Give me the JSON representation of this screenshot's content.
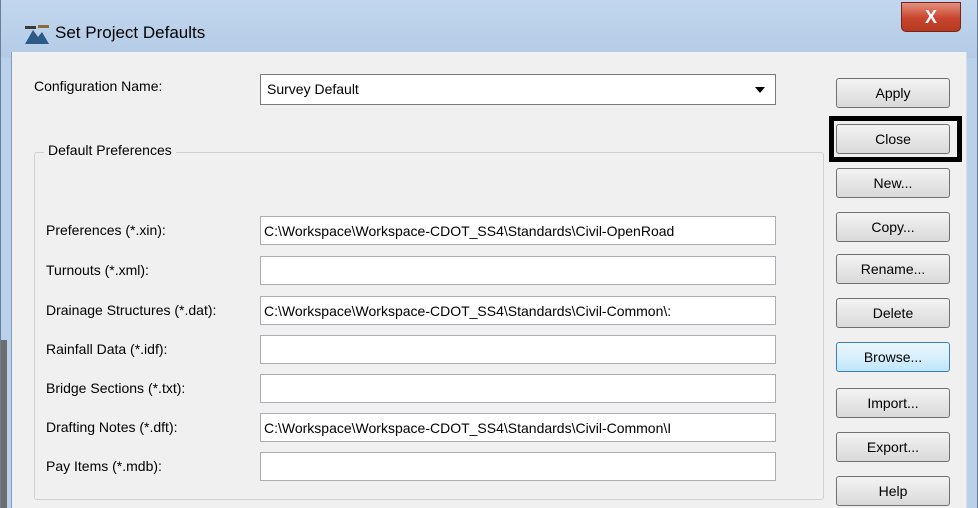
{
  "window": {
    "title": "Set Project Defaults",
    "close_glyph": "X"
  },
  "config": {
    "label": "Configuration Name:",
    "selected": "Survey Default"
  },
  "group": {
    "title": "Default Preferences"
  },
  "fields": [
    {
      "label": "Preferences (*.xin):",
      "value": "C:\\Workspace\\Workspace-CDOT_SS4\\Standards\\Civil-OpenRoad"
    },
    {
      "label": "Turnouts (*.xml):",
      "value": ""
    },
    {
      "label": "Drainage Structures (*.dat):",
      "value": "C:\\Workspace\\Workspace-CDOT_SS4\\Standards\\Civil-Common\\:"
    },
    {
      "label": "Rainfall Data (*.idf):",
      "value": ""
    },
    {
      "label": "Bridge Sections (*.txt):",
      "value": ""
    },
    {
      "label": "Drafting Notes (*.dft):",
      "value": "C:\\Workspace\\Workspace-CDOT_SS4\\Standards\\Civil-Common\\I"
    },
    {
      "label": "Pay Items (*.mdb):",
      "value": ""
    }
  ],
  "buttons": {
    "apply": "Apply",
    "close": "Close",
    "new": "New...",
    "copy": "Copy...",
    "rename": "Rename...",
    "delete": "Delete",
    "browse": "Browse...",
    "import": "Import...",
    "export": "Export...",
    "help": "Help"
  }
}
